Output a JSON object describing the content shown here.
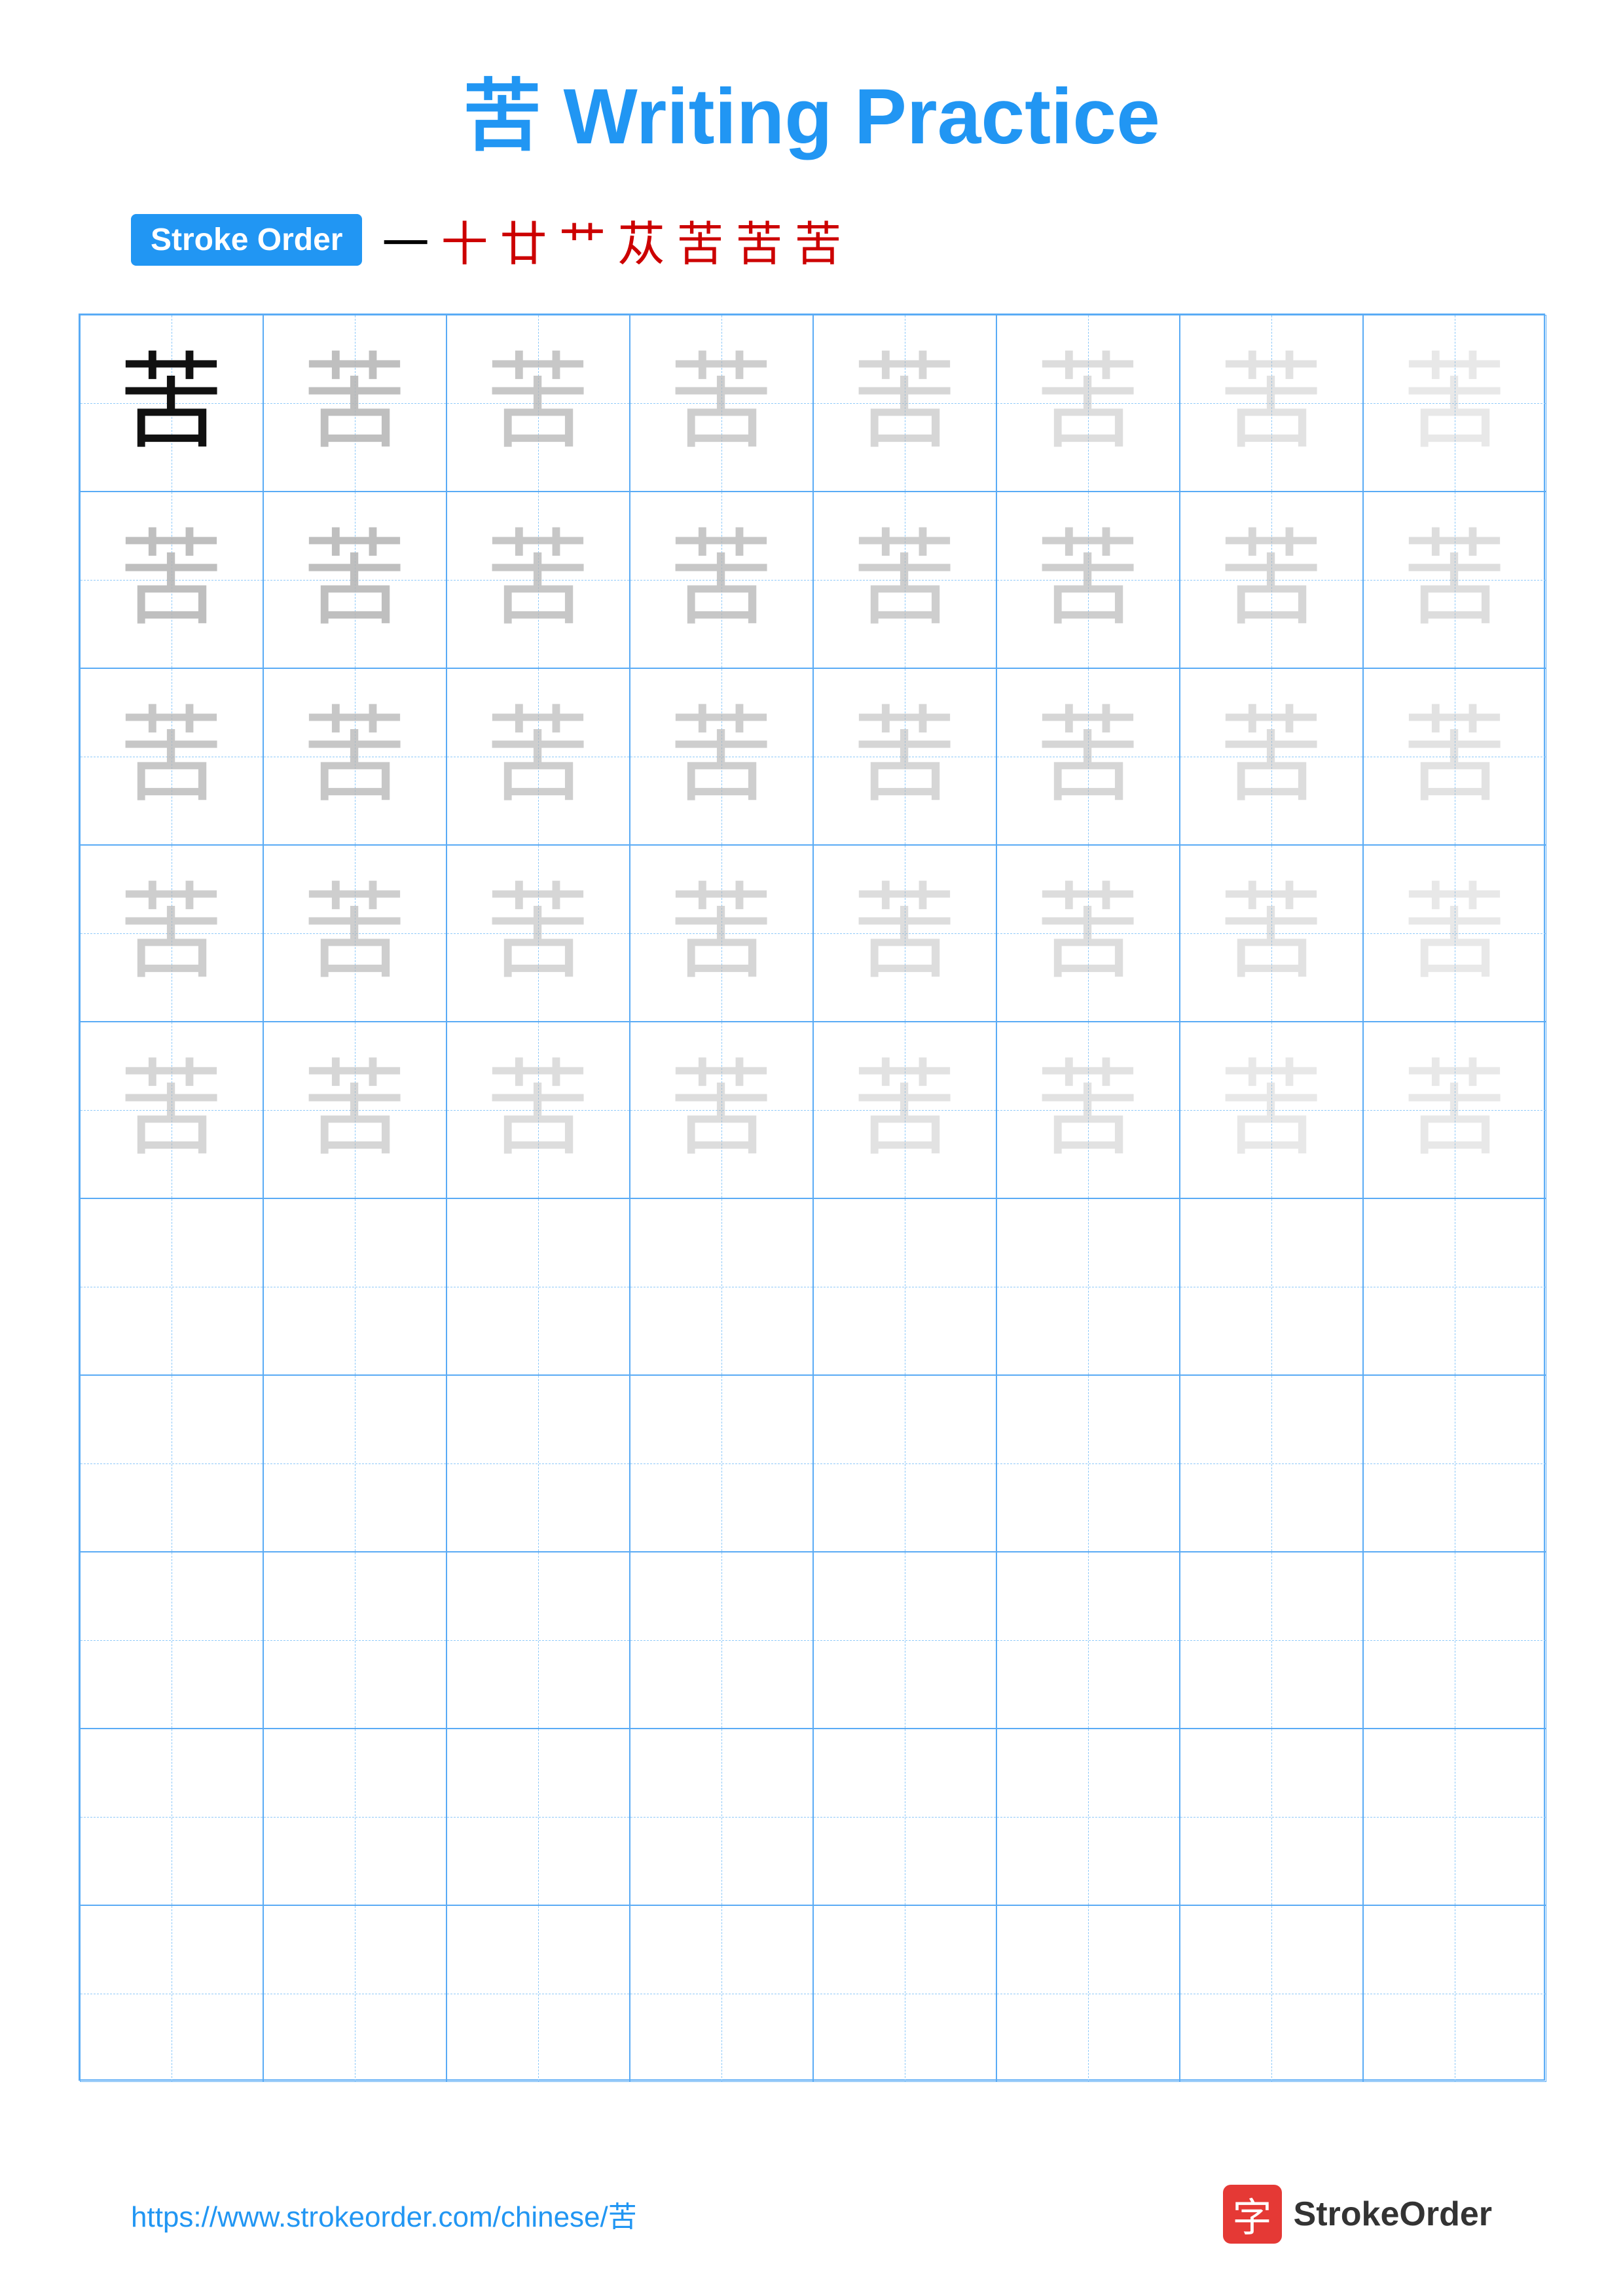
{
  "title": "苦 Writing Practice",
  "stroke_order_badge": "Stroke Order",
  "stroke_chars": [
    "一",
    "十",
    "廿",
    "艹",
    "艹",
    "苪",
    "苦",
    "苦"
  ],
  "character": "苦",
  "grid": {
    "rows": 10,
    "cols": 8,
    "practice_rows": 5,
    "empty_rows": 5
  },
  "footer": {
    "url": "https://www.strokeorder.com/chinese/苦",
    "logo_char": "字",
    "logo_text": "StrokeOrder"
  }
}
